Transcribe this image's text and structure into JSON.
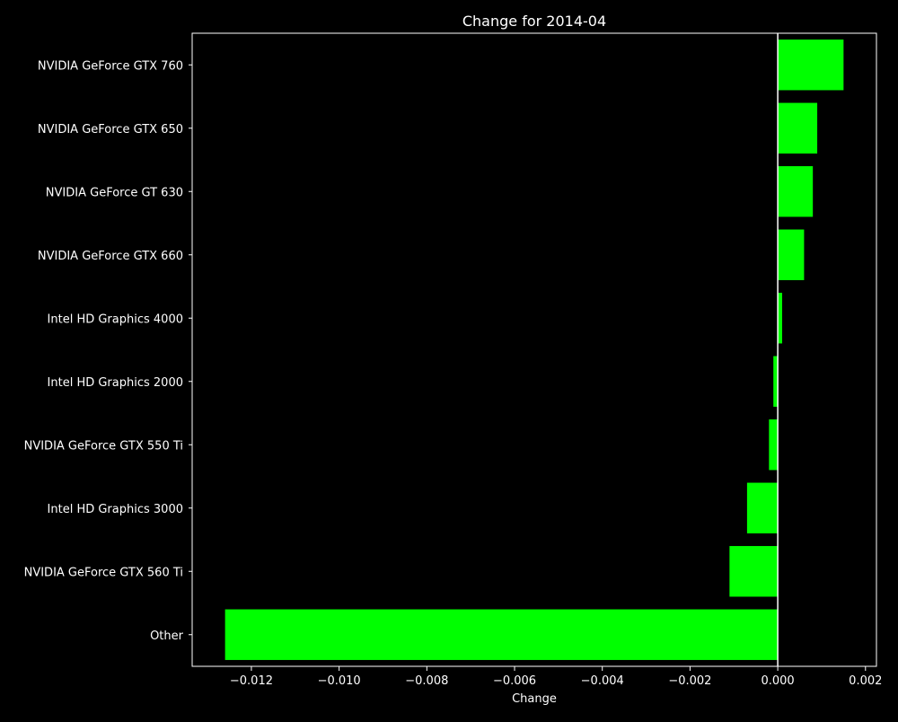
{
  "colors": {
    "background": "#000000",
    "foreground": "#ffffff",
    "bar": "#00ff00"
  },
  "chart_data": {
    "type": "bar",
    "orientation": "horizontal",
    "title": "Change for 2014-04",
    "xlabel": "Change",
    "ylabel": "",
    "xlim": [
      -0.01335,
      0.00225
    ],
    "xticks": [
      -0.012,
      -0.01,
      -0.008,
      -0.006,
      -0.004,
      -0.002,
      0.0,
      0.002
    ],
    "xtick_labels": [
      "−0.012",
      "−0.010",
      "−0.008",
      "−0.006",
      "−0.004",
      "−0.002",
      "0.000",
      "0.002"
    ],
    "grid": false,
    "zero_line": true,
    "categories": [
      "NVIDIA GeForce GTX 760",
      "NVIDIA GeForce GTX 650",
      "NVIDIA GeForce GT 630",
      "NVIDIA GeForce GTX 660",
      "Intel HD Graphics 4000",
      "Intel HD Graphics 2000",
      "NVIDIA GeForce GTX 550 Ti",
      "Intel HD Graphics 3000",
      "NVIDIA GeForce GTX 560 Ti",
      "Other"
    ],
    "values": [
      0.0015,
      0.0009,
      0.0008,
      0.0006,
      0.0001,
      -0.0001,
      -0.0002,
      -0.0007,
      -0.0011,
      -0.0126
    ]
  }
}
